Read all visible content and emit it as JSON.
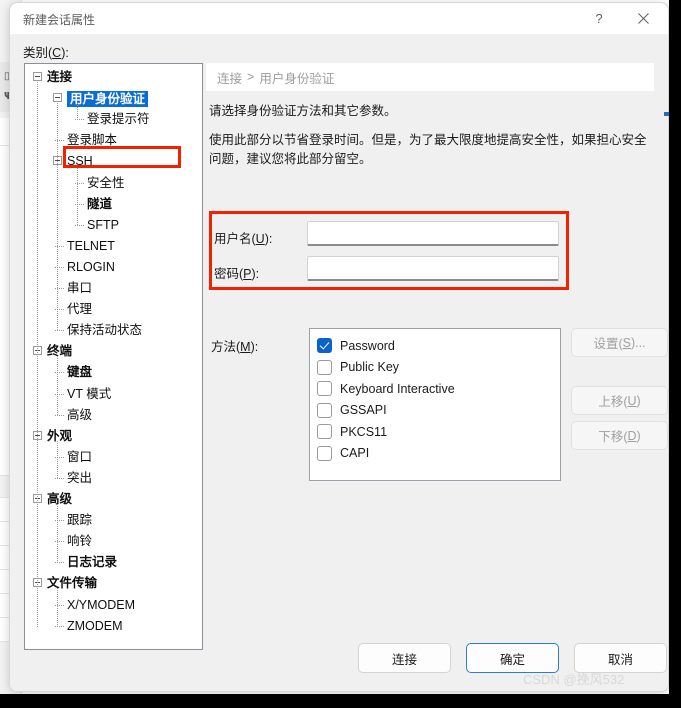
{
  "window": {
    "title": "新建会话属性",
    "help_icon": "question-mark-icon",
    "close_icon": "close-icon"
  },
  "category": {
    "label": "类别(C):",
    "label_text": "类别(",
    "accel": "C",
    "label_tail": "):"
  },
  "tree": {
    "nodes": [
      {
        "label": "连接",
        "level": 0,
        "bold": true,
        "expander": "collapse",
        "selected": false
      },
      {
        "label": "用户身份验证",
        "level": 1,
        "bold": true,
        "expander": "collapse",
        "selected": true
      },
      {
        "label": "登录提示符",
        "level": 2,
        "bold": false,
        "expander": "none",
        "selected": false
      },
      {
        "label": "登录脚本",
        "level": 1,
        "bold": false,
        "expander": "none",
        "selected": false
      },
      {
        "label": "SSH",
        "level": 1,
        "bold": false,
        "expander": "collapse",
        "selected": false
      },
      {
        "label": "安全性",
        "level": 2,
        "bold": false,
        "expander": "none",
        "selected": false
      },
      {
        "label": "隧道",
        "level": 2,
        "bold": true,
        "expander": "none",
        "selected": false
      },
      {
        "label": "SFTP",
        "level": 2,
        "bold": false,
        "expander": "none",
        "selected": false
      },
      {
        "label": "TELNET",
        "level": 1,
        "bold": false,
        "expander": "none",
        "selected": false
      },
      {
        "label": "RLOGIN",
        "level": 1,
        "bold": false,
        "expander": "none",
        "selected": false
      },
      {
        "label": "串口",
        "level": 1,
        "bold": false,
        "expander": "none",
        "selected": false
      },
      {
        "label": "代理",
        "level": 1,
        "bold": false,
        "expander": "none",
        "selected": false
      },
      {
        "label": "保持活动状态",
        "level": 1,
        "bold": false,
        "expander": "none",
        "selected": false
      },
      {
        "label": "终端",
        "level": 0,
        "bold": true,
        "expander": "collapse",
        "selected": false
      },
      {
        "label": "键盘",
        "level": 1,
        "bold": true,
        "expander": "none",
        "selected": false
      },
      {
        "label": "VT 模式",
        "level": 1,
        "bold": false,
        "expander": "none",
        "selected": false
      },
      {
        "label": "高级",
        "level": 1,
        "bold": false,
        "expander": "none",
        "selected": false
      },
      {
        "label": "外观",
        "level": 0,
        "bold": true,
        "expander": "collapse",
        "selected": false
      },
      {
        "label": "窗口",
        "level": 1,
        "bold": false,
        "expander": "none",
        "selected": false
      },
      {
        "label": "突出",
        "level": 1,
        "bold": false,
        "expander": "none",
        "selected": false
      },
      {
        "label": "高级",
        "level": 0,
        "bold": true,
        "expander": "collapse",
        "selected": false
      },
      {
        "label": "跟踪",
        "level": 1,
        "bold": false,
        "expander": "none",
        "selected": false
      },
      {
        "label": "响铃",
        "level": 1,
        "bold": false,
        "expander": "none",
        "selected": false
      },
      {
        "label": "日志记录",
        "level": 1,
        "bold": true,
        "expander": "none",
        "selected": false
      },
      {
        "label": "文件传输",
        "level": 0,
        "bold": true,
        "expander": "collapse",
        "selected": false
      },
      {
        "label": "X/YMODEM",
        "level": 1,
        "bold": false,
        "expander": "none",
        "selected": false
      },
      {
        "label": "ZMODEM",
        "level": 1,
        "bold": false,
        "expander": "none",
        "selected": false
      }
    ]
  },
  "breadcrumb": {
    "parent": "连接",
    "separator": ">",
    "current": "用户身份验证"
  },
  "description": {
    "line1": "请选择身份验证方法和其它参数。",
    "line2": "使用此部分以节省登录时间。但是，为了最大限度地提高安全性，如果担心安全问题，建议您将此部分留空。"
  },
  "credentials": {
    "username_label": "用户名(U):",
    "username_label_text": "用户名(",
    "username_accel": "U",
    "username_label_tail": "):",
    "username_value": "",
    "password_label": "密码(P):",
    "password_label_text": "密码(",
    "password_accel": "P",
    "password_label_tail": "):",
    "password_value": ""
  },
  "methods": {
    "label": "方法(M):",
    "label_text": "方法(",
    "accel": "M",
    "label_tail": "):",
    "items": [
      {
        "label": "Password",
        "checked": true
      },
      {
        "label": "Public Key",
        "checked": false
      },
      {
        "label": "Keyboard Interactive",
        "checked": false
      },
      {
        "label": "GSSAPI",
        "checked": false
      },
      {
        "label": "PKCS11",
        "checked": false
      },
      {
        "label": "CAPI",
        "checked": false
      }
    ]
  },
  "side_buttons": [
    {
      "label": "设置(S)...",
      "text": "设置(",
      "accel": "S",
      "tail": ")...",
      "enabled": false
    },
    {
      "label": "上移(U)",
      "text": "上移(",
      "accel": "U",
      "tail": ")",
      "enabled": false
    },
    {
      "label": "下移(D)",
      "text": "下移(",
      "accel": "D",
      "tail": ")",
      "enabled": false
    }
  ],
  "footer_buttons": [
    {
      "label": "连接",
      "primary": false
    },
    {
      "label": "确定",
      "primary": true
    },
    {
      "label": "取消",
      "primary": false
    }
  ],
  "watermark": "CSDN @挽风532",
  "colors": {
    "accent": "#0a6cd4",
    "highlight_box": "#f42100",
    "dialog_bg": "#f0f0f0",
    "panel_bg": "#ffffff"
  }
}
